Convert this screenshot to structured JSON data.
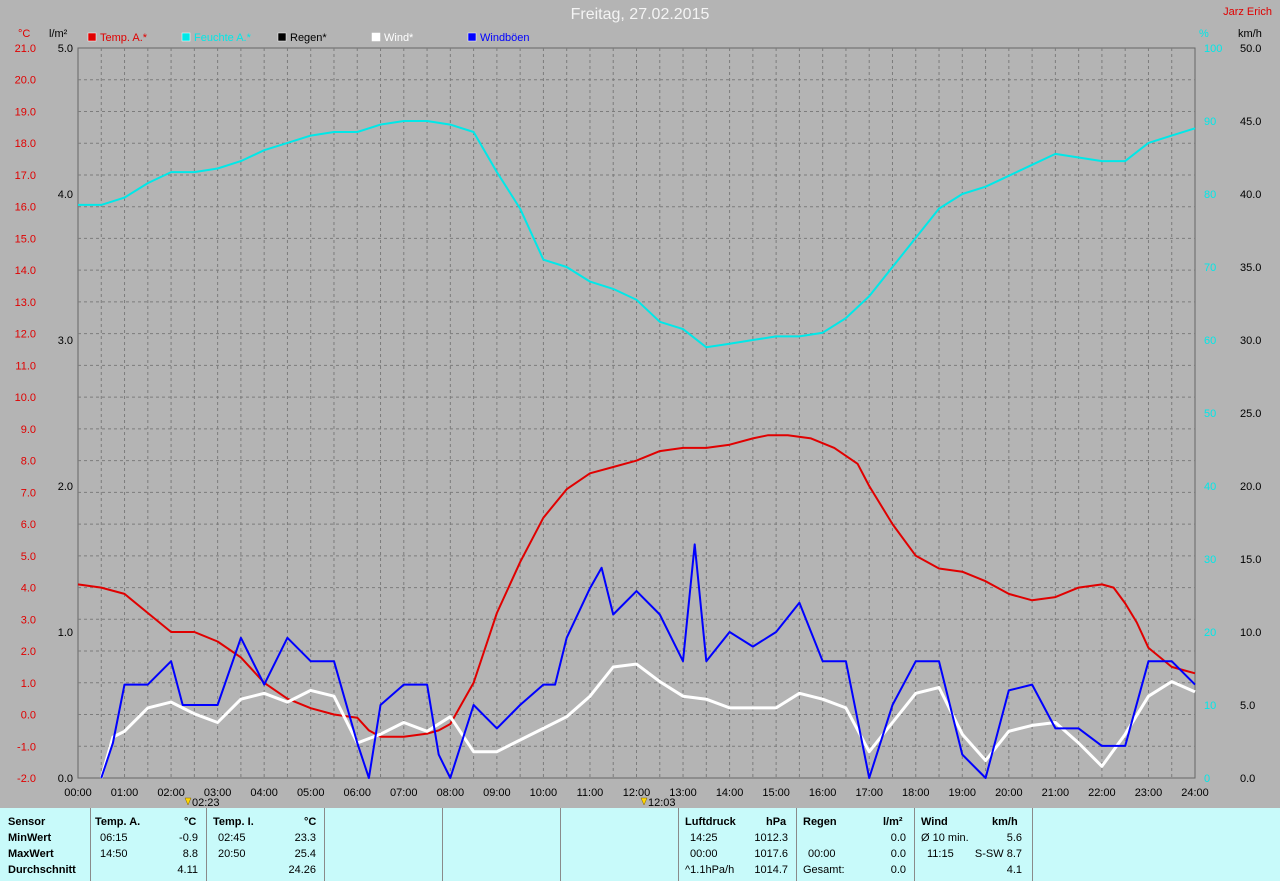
{
  "title": "Freitag, 27.02.2015",
  "author": "Jarz Erich",
  "chart_data": {
    "type": "line",
    "x_ticks": [
      "00:00",
      "01:00",
      "02:00",
      "03:00",
      "04:00",
      "05:00",
      "06:00",
      "07:00",
      "08:00",
      "09:00",
      "10:00",
      "11:00",
      "12:00",
      "13:00",
      "14:00",
      "15:00",
      "16:00",
      "17:00",
      "18:00",
      "19:00",
      "20:00",
      "21:00",
      "22:00",
      "23:00",
      "24:00"
    ],
    "axes": {
      "temp": {
        "unit": "°C",
        "min": -2,
        "max": 21,
        "ticks": [
          "21.0",
          "20.0",
          "19.0",
          "18.0",
          "17.0",
          "16.0",
          "15.0",
          "14.0",
          "13.0",
          "12.0",
          "11.0",
          "10.0",
          "9.0",
          "8.0",
          "7.0",
          "6.0",
          "5.0",
          "4.0",
          "3.0",
          "2.0",
          "1.0",
          "0.0",
          "-1.0",
          "-2.0"
        ]
      },
      "rain": {
        "unit": "l/m²",
        "min": 0,
        "max": 5,
        "ticks": [
          "5.0",
          "4.0",
          "3.0",
          "2.0",
          "1.0",
          "0.0"
        ]
      },
      "humidity": {
        "unit": "%",
        "min": 0,
        "max": 100,
        "ticks": [
          "100",
          "90",
          "80",
          "70",
          "60",
          "50",
          "40",
          "30",
          "20",
          "10",
          "0"
        ]
      },
      "wind": {
        "unit": "km/h",
        "min": 0,
        "max": 50,
        "ticks": [
          "50.0",
          "45.0",
          "40.0",
          "35.0",
          "30.0",
          "25.0",
          "20.0",
          "15.0",
          "10.0",
          "5.0",
          "0.0"
        ]
      }
    },
    "legend": [
      {
        "name": "Temp. A.*",
        "color": "#e00000"
      },
      {
        "name": "Feuchte A.*",
        "color": "#00e8e8"
      },
      {
        "name": "Regen*",
        "color": "#000000"
      },
      {
        "name": "Wind*",
        "color": "#ffffff"
      },
      {
        "name": "Windböen",
        "color": "#0000ff"
      }
    ],
    "series": [
      {
        "name": "Temp. A.*",
        "axis": "temp",
        "color": "#e00000",
        "x": [
          0,
          0.5,
          1,
          1.5,
          2,
          2.5,
          3,
          3.5,
          4,
          4.5,
          5,
          5.5,
          6,
          6.25,
          6.5,
          7,
          7.5,
          7.75,
          8,
          8.5,
          9,
          9.5,
          10,
          10.5,
          11,
          11.5,
          12,
          12.5,
          13,
          13.5,
          14,
          14.5,
          14.83,
          15.25,
          15.75,
          16.25,
          16.75,
          17,
          17.5,
          18,
          18.5,
          19,
          19.5,
          20,
          20.5,
          21,
          21.5,
          22,
          22.25,
          22.5,
          22.75,
          23,
          23.25,
          23.5,
          23.75,
          24
        ],
        "y": [
          4.1,
          4.0,
          3.8,
          3.2,
          2.6,
          2.6,
          2.3,
          1.8,
          1.0,
          0.5,
          0.2,
          0.0,
          -0.1,
          -0.5,
          -0.7,
          -0.7,
          -0.6,
          -0.5,
          -0.3,
          1.0,
          3.2,
          4.8,
          6.2,
          7.1,
          7.6,
          7.8,
          8.0,
          8.3,
          8.4,
          8.4,
          8.5,
          8.7,
          8.8,
          8.8,
          8.7,
          8.4,
          7.9,
          7.2,
          6.0,
          5.0,
          4.6,
          4.5,
          4.2,
          3.8,
          3.6,
          3.7,
          4.0,
          4.1,
          4.0,
          3.5,
          2.9,
          2.1,
          1.8,
          1.5,
          1.4,
          1.3
        ]
      },
      {
        "name": "Feuchte A.*",
        "axis": "humidity",
        "color": "#00e8e8",
        "x": [
          0,
          0.5,
          1,
          1.5,
          2,
          2.5,
          3,
          3.5,
          4,
          4.5,
          5,
          5.5,
          6,
          6.5,
          7,
          7.5,
          8,
          8.5,
          9,
          9.5,
          10,
          10.5,
          11,
          11.5,
          12,
          12.5,
          13,
          13.5,
          14,
          14.5,
          15,
          15.5,
          16,
          16.5,
          17,
          17.5,
          18,
          18.5,
          19,
          19.5,
          20,
          20.5,
          21,
          21.5,
          22,
          22.5,
          23,
          23.5,
          24
        ],
        "y": [
          78.5,
          78.5,
          79.5,
          81.5,
          83,
          83,
          83.5,
          84.5,
          86,
          87,
          88,
          88.5,
          88.5,
          89.5,
          90,
          90,
          89.5,
          88.5,
          83,
          78,
          71,
          70,
          68,
          67,
          65.5,
          62.5,
          61.5,
          59,
          59.5,
          60,
          60.5,
          60.5,
          61,
          63,
          66,
          70,
          74,
          78,
          80,
          81,
          82.5,
          84,
          85.5,
          85,
          84.5,
          84.5,
          87,
          88,
          89
        ]
      },
      {
        "name": "Wind*",
        "axis": "wind",
        "color": "#ffffff",
        "x": [
          0.5,
          0.75,
          1,
          1.5,
          2,
          2.5,
          3,
          3.5,
          4,
          4.5,
          5,
          5.5,
          6,
          6.5,
          7,
          7.5,
          8,
          8.5,
          9,
          9.5,
          10,
          10.5,
          11,
          11.5,
          12,
          12.5,
          13,
          13.5,
          14,
          14.5,
          15,
          15.5,
          16,
          16.5,
          17,
          17.5,
          18,
          18.5,
          19,
          19.5,
          20,
          20.5,
          21,
          21.5,
          22,
          22.5,
          23,
          23.5,
          24
        ],
        "y": [
          0,
          2.8,
          3.2,
          4.8,
          5.2,
          4.4,
          3.8,
          5.4,
          5.8,
          5.2,
          6.0,
          5.6,
          2.4,
          3.0,
          3.8,
          3.2,
          4.2,
          1.8,
          1.8,
          2.6,
          3.4,
          4.2,
          5.6,
          7.6,
          7.8,
          6.6,
          5.6,
          5.4,
          4.8,
          4.8,
          4.8,
          5.8,
          5.4,
          4.8,
          1.8,
          3.8,
          5.8,
          6.2,
          3.0,
          1.2,
          3.2,
          3.6,
          3.8,
          2.4,
          0.8,
          3.0,
          5.6,
          6.6,
          5.9
        ]
      },
      {
        "name": "Windböen",
        "axis": "wind",
        "color": "#0000ff",
        "x": [
          0.5,
          0.75,
          1,
          1.5,
          2,
          2.25,
          2.5,
          3,
          3.5,
          4,
          4.5,
          5,
          5.5,
          6,
          6.25,
          6.5,
          7,
          7.5,
          7.75,
          8,
          8.5,
          9,
          9.5,
          10,
          10.25,
          10.5,
          11,
          11.25,
          11.5,
          12,
          12.5,
          13,
          13.25,
          13.5,
          14,
          14.5,
          15,
          15.5,
          16,
          16.5,
          17,
          17.5,
          18,
          18.5,
          19,
          19.5,
          20,
          20.5,
          21,
          21.5,
          22,
          22.5,
          23,
          23.5,
          24
        ],
        "y": [
          0,
          2.4,
          6.4,
          6.4,
          8.0,
          5.0,
          5.0,
          5.0,
          9.6,
          6.4,
          9.6,
          8.0,
          8.0,
          2.4,
          0,
          5.0,
          6.4,
          6.4,
          1.6,
          0,
          5.0,
          3.4,
          5.0,
          6.4,
          6.4,
          9.6,
          13.0,
          14.4,
          11.2,
          12.8,
          11.2,
          8.0,
          16.0,
          8.0,
          10.0,
          9.0,
          10.0,
          12.0,
          8.0,
          8.0,
          0,
          5.0,
          8.0,
          8.0,
          1.6,
          0,
          6.0,
          6.4,
          3.4,
          3.4,
          2.2,
          2.2,
          8.0,
          8.0,
          6.4
        ]
      }
    ],
    "markers": [
      {
        "label": "02:23"
      },
      {
        "label": "12:03"
      }
    ]
  },
  "table": {
    "sensor_col": {
      "header": "Sensor",
      "rows": [
        "MinWert",
        "MaxWert",
        "Durchschnitt"
      ]
    },
    "temp_a": {
      "header": "Temp. A.",
      "unit": "°C",
      "times": [
        "06:15",
        "14:50",
        ""
      ],
      "values": [
        "-0.9",
        "8.8",
        "4.11"
      ]
    },
    "temp_i": {
      "header": "Temp. I.",
      "unit": "°C",
      "times": [
        "02:45",
        "20:50",
        ""
      ],
      "values": [
        "23.3",
        "25.4",
        "24.26"
      ]
    },
    "luftdruck": {
      "header": "Luftdruck",
      "unit": "hPa",
      "times": [
        "14:25",
        "00:00",
        "^1.1hPa/h"
      ],
      "values": [
        "1012.3",
        "1017.6",
        "1014.7"
      ]
    },
    "regen": {
      "header": "Regen",
      "unit": "l/m²",
      "times": [
        "",
        "00:00",
        "Gesamt:"
      ],
      "values": [
        "0.0",
        "0.0",
        "0.0"
      ]
    },
    "wind": {
      "header": "Wind",
      "unit": "km/h",
      "times": [
        "Ø 10 min.",
        "11:15",
        ""
      ],
      "values": [
        "5.6",
        "S-SW 8.7",
        "4.1"
      ]
    }
  }
}
